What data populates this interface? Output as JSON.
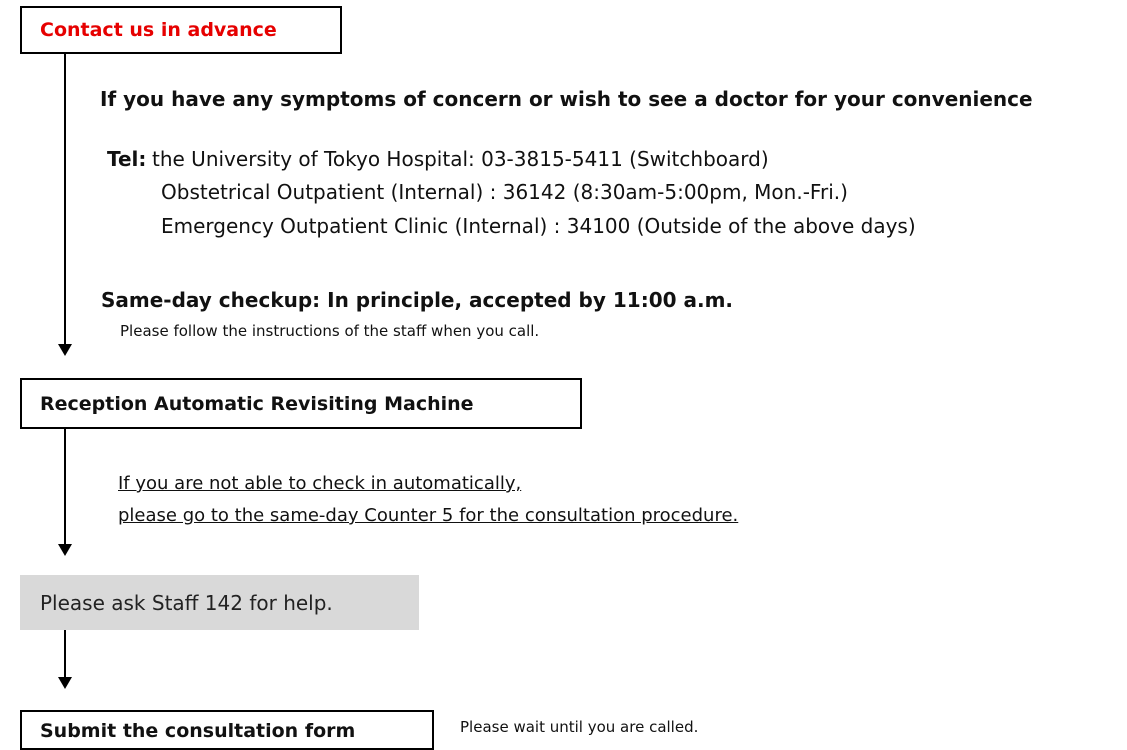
{
  "step1": {
    "box_label": "Contact us in advance",
    "box_label_color": "#e60000",
    "symptoms_heading": "If you have any symptoms of concern or wish to see a doctor for your convenience",
    "tel_label": "Tel:",
    "tel_lines": [
      "the University of Tokyo Hospital:   03-3815-5411 (Switchboard)",
      "Obstetrical Outpatient (Internal) :    36142 (8:30am-5:00pm, Mon.-Fri.)",
      "Emergency Outpatient Clinic (Internal) :  34100 (Outside of the above days)"
    ],
    "sameday_heading": "Same-day checkup: In principle, accepted by 11:00 a.m.",
    "sameday_note": "Please follow the instructions of the staff when you call."
  },
  "step2": {
    "box_label": "Reception Automatic Revisiting Machine",
    "note_line1": "If you are not able to check in automatically,",
    "note_line2": "please go to the same-day Counter 5 for the consultation procedure."
  },
  "step3": {
    "box_label": "Please ask Staff 142 for help.",
    "box_bg": "#d9d9d9"
  },
  "step4": {
    "box_label": "Submit the consultation form",
    "side_note": "Please wait until you are called."
  }
}
